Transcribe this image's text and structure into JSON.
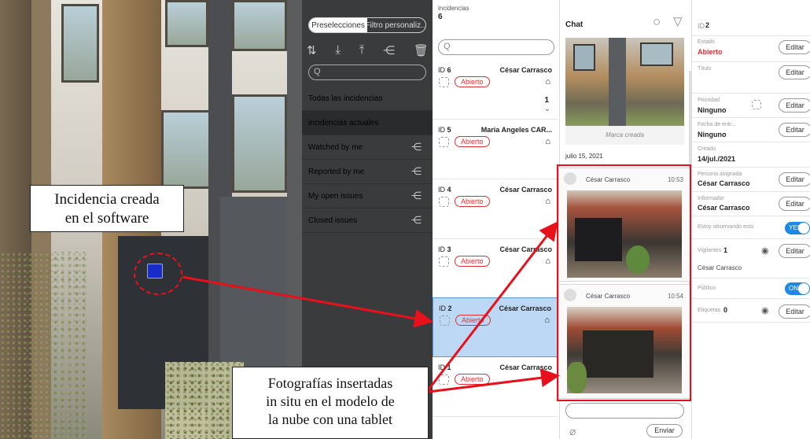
{
  "viewer": {
    "callout_top": [
      "Incidencia creada",
      "en el software"
    ],
    "callout_bottom": [
      "Fotografías insertadas",
      "in situ en el modelo de",
      "la nube con una tablet"
    ]
  },
  "sidebar": {
    "seg_on": "Preselecciones",
    "seg_off": "Filtro personaliz...",
    "search_icon": "Q",
    "items": [
      {
        "label": "Todas las incidencias"
      },
      {
        "label": "incidencias actuales"
      },
      {
        "label": "Watched by me"
      },
      {
        "label": "Reported by me"
      },
      {
        "label": "My open issues"
      },
      {
        "label": "Closed issues"
      }
    ]
  },
  "list": {
    "title": "incidencias",
    "count": "6",
    "search_icon": "Q",
    "cards": [
      {
        "id": "6",
        "who": "César Carrasco",
        "status": "Abierto",
        "extra": "1"
      },
      {
        "id": "5",
        "who": "Maria Angeles CAR...",
        "status": "Abierto"
      },
      {
        "id": "4",
        "who": "César Carrasco",
        "status": "Abierto"
      },
      {
        "id": "3",
        "who": "César Carrasco",
        "status": "Abierto"
      },
      {
        "id": "2",
        "who": "César Carrasco",
        "status": "Abierto"
      },
      {
        "id": "1",
        "who": "César Carrasco",
        "status": "Abierto"
      }
    ]
  },
  "chat": {
    "title": "Chat",
    "caption": "Marca creada",
    "date": "julio 15, 2021",
    "messages": [
      {
        "author": "César Carrasco",
        "time": "10:53"
      },
      {
        "author": "César Carrasco",
        "time": "10:54"
      }
    ],
    "send": "Enviar"
  },
  "details": {
    "id_label": "ID",
    "id_value": "2",
    "edit": "Editar",
    "estado_label": "Estado",
    "estado_value": "Abierto",
    "titulo_label": "Título",
    "prioridad_label": "Prioridad",
    "prioridad_value": "Ninguno",
    "fecha_label": "Fecha de entr...",
    "fecha_value": "Ninguno",
    "creado_label": "Creado",
    "creado_value": "14/jul./2021",
    "asignada_label": "Persona asignada",
    "asignada_value": "César Carrasco",
    "informador_label": "Informador",
    "informador_value": "César Carrasco",
    "observando_label": "Estoy observando esto",
    "observando_value": "YES",
    "vigilantes_label": "Vigilantes",
    "vigilantes_count": "1",
    "vigilantes_name": "César Carrasco",
    "publico_label": "Público",
    "publico_value": "ON",
    "etiquetas_label": "Etiquetas",
    "etiquetas_count": "0"
  },
  "colors": {
    "accent": "#1e88e5",
    "status": "#d33333",
    "annotation": "#e8101a",
    "sidebar": "#3a3b3c"
  }
}
